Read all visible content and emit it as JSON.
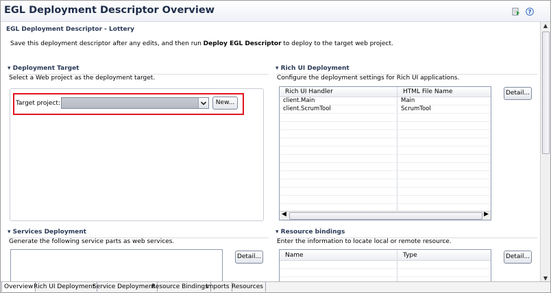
{
  "header": {
    "title": "EGL Deployment Descriptor Overview",
    "run_icon": "run-icon",
    "help_icon": "help-icon"
  },
  "intro": {
    "heading": "EGL Deployment Descriptor - Lottery",
    "text_before": "Save this deployment descriptor after any edits, and then run ",
    "text_bold": "Deploy EGL Descriptor",
    "text_after": " to deploy to the target web project."
  },
  "deployment_target": {
    "title": "Deployment Target",
    "description": "Select a Web project as the deployment target.",
    "field_label": "Target project:",
    "field_value": "",
    "new_button": "New..."
  },
  "rich_ui": {
    "title": "Rich UI Deployment",
    "description": "Configure the deployment settings for Rich UI applications.",
    "columns": [
      "Rich UI Handler",
      "HTML File Name"
    ],
    "rows": [
      [
        "client.Main",
        "Main"
      ],
      [
        "client.ScrumTool",
        "ScrumTool"
      ]
    ],
    "detail_button": "Detail..."
  },
  "services": {
    "title": "Services Deployment",
    "description": "Generate the following service parts as web services.",
    "detail_button": "Detail..."
  },
  "resources": {
    "title": "Resource bindings",
    "description": "Enter the information to locate local or remote resource.",
    "columns": [
      "Name",
      "Type"
    ],
    "detail_button": "Detail..."
  },
  "tabs": [
    "Overview",
    "Rich UI Deployment",
    "Service Deployment",
    "Resource Bindings",
    "Imports",
    "Resources"
  ],
  "colors": {
    "highlight": "#e0141e",
    "title": "#1e2d4a"
  }
}
